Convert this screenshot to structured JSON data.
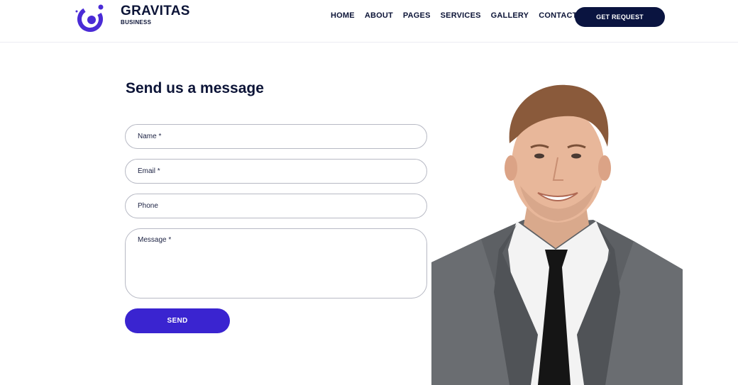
{
  "brand": {
    "name": "GRAVITAS",
    "tagline": "BUSINESS"
  },
  "nav": {
    "items": [
      {
        "label": "HOME"
      },
      {
        "label": "ABOUT"
      },
      {
        "label": "PAGES"
      },
      {
        "label": "SERVICES"
      },
      {
        "label": "GALLERY"
      },
      {
        "label": "CONTACTS"
      }
    ],
    "cta_label": "GET REQUEST"
  },
  "form": {
    "title": "Send us a message",
    "name_placeholder": "Name *",
    "email_placeholder": "Email *",
    "phone_placeholder": "Phone",
    "message_placeholder": "Message *",
    "send_label": "SEND"
  },
  "colors": {
    "brand_accent": "#3a24d0",
    "navy": "#0a1440",
    "field_border": "#b7b9c4"
  },
  "icons": {
    "logo": "brand-logo-icon"
  }
}
